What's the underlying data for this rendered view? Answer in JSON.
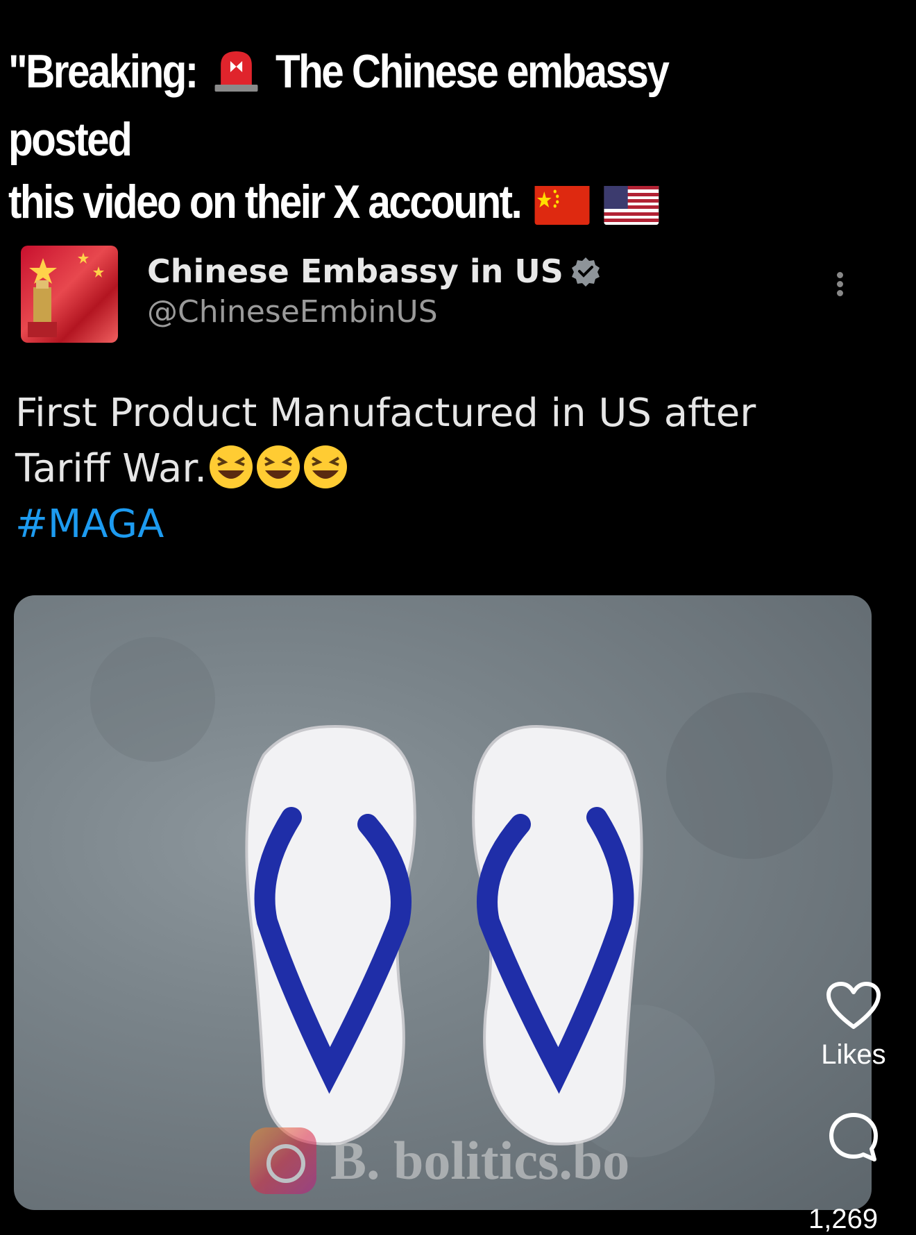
{
  "caption": {
    "line1_before": "\"Breaking:",
    "line1_after": "The Chinese embassy posted",
    "line2": "this video on their X account.",
    "siren_icon": "police-light-emoji",
    "flags": [
      "china-flag",
      "usa-flag"
    ]
  },
  "tweet": {
    "author_name": "Chinese Embassy in US",
    "handle": "@ChineseEmbinUS",
    "text_line1": "First Product Manufactured in US after",
    "text_line2": "Tariff War.",
    "laugh_emoji": "laughing-face-emoji",
    "hashtag": "#MAGA"
  },
  "media": {
    "description_icon": "flip-flops",
    "watermark": "B. bolitics.bo"
  },
  "actions": {
    "like_label": "Likes",
    "comment_count": "1,269"
  },
  "colors": {
    "background": "#000000",
    "hashtag": "#1d9bf0",
    "strap": "#1f2ea8"
  }
}
